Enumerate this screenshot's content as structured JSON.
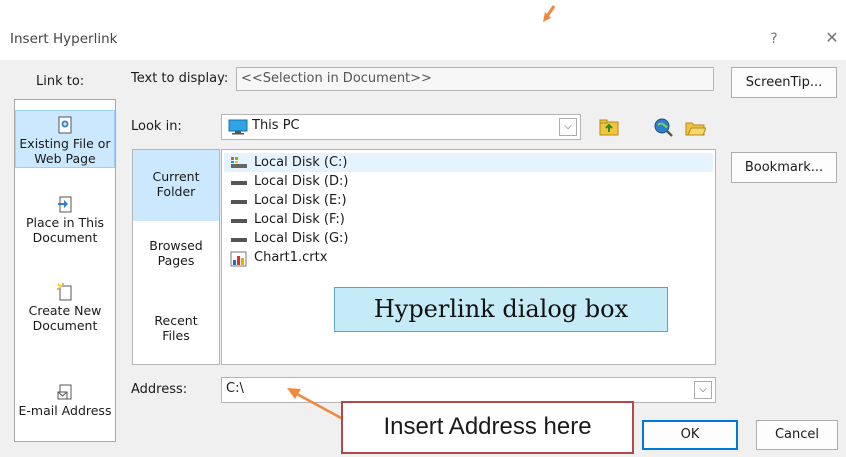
{
  "window": {
    "title": "Insert Hyperlink",
    "help_glyph": "?",
    "close_glyph": "✕"
  },
  "link_to": {
    "label": "Link to:",
    "items": [
      {
        "line1": "Existing File or",
        "line2": "Web Page",
        "icon": "existing-file-icon",
        "selected": true
      },
      {
        "line1": "Place in This",
        "line2": "Document",
        "icon": "place-in-document-icon",
        "selected": false
      },
      {
        "line1": "Create New",
        "line2": "Document",
        "icon": "create-new-document-icon",
        "selected": false
      },
      {
        "line1": "E-mail Address",
        "line2": "",
        "icon": "email-address-icon",
        "selected": false
      }
    ]
  },
  "text_to_display": {
    "label": "Text to display:",
    "value": "<<Selection in Document>>"
  },
  "screentip_button": "ScreenTip...",
  "look_in": {
    "label": "Look in:",
    "value": "This PC",
    "icon": "this-pc-icon"
  },
  "toolbar_icons": [
    "up-folder-icon",
    "browse-web-icon",
    "browse-file-icon"
  ],
  "views": [
    {
      "line1": "Current",
      "line2": "Folder",
      "selected": true
    },
    {
      "line1": "Browsed",
      "line2": "Pages",
      "selected": false
    },
    {
      "line1": "Recent",
      "line2": "Files",
      "selected": false
    }
  ],
  "files": [
    {
      "name": "Local Disk (C:)",
      "icon": "system-drive-icon",
      "selected": true
    },
    {
      "name": "Local Disk (D:)",
      "icon": "drive-icon",
      "selected": false
    },
    {
      "name": "Local Disk (E:)",
      "icon": "drive-icon",
      "selected": false
    },
    {
      "name": "Local Disk (F:)",
      "icon": "drive-icon",
      "selected": false
    },
    {
      "name": "Local Disk (G:)",
      "icon": "drive-icon",
      "selected": false
    },
    {
      "name": "Chart1.crtx",
      "icon": "chart-file-icon",
      "selected": false
    }
  ],
  "bookmark_button": "Bookmark...",
  "address": {
    "label": "Address:",
    "value": "C:\\"
  },
  "ok_button": "OK",
  "cancel_button": "Cancel",
  "annotations": {
    "dialog_label": "Hyperlink dialog box",
    "address_label": "Insert Address here",
    "arrow_color": "#f0883e"
  },
  "colors": {
    "selection": "#cce8ff",
    "default_button_border": "#0078d7",
    "callout_fill": "#c5ebf7",
    "callout_border": "#5ba4c6",
    "address_callout_border": "#b54848"
  }
}
